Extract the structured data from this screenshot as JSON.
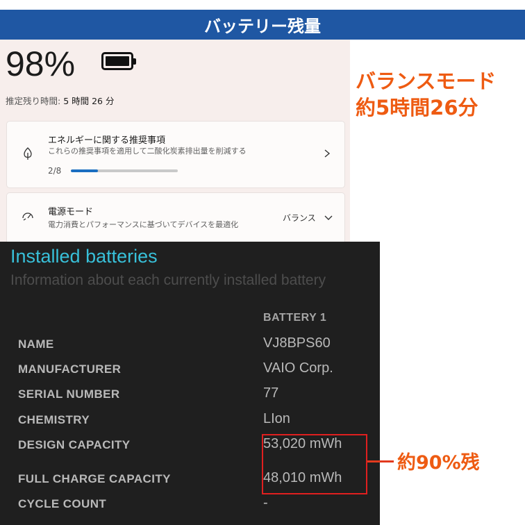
{
  "title": "バッテリー残量",
  "settings": {
    "percentage": "98%",
    "remaining_label": "推定残り時間:",
    "remaining_value": "5 時間 26 分",
    "recommendation": {
      "title": "エネルギーに関する推奨事項",
      "subtitle": "これらの推奨事項を適用して二酸化炭素排出量を削減する",
      "progress_label": "2/8",
      "progress_fraction": 0.25,
      "icon": "leaf-icon"
    },
    "power_mode": {
      "title": "電源モード",
      "subtitle": "電力消費とパフォーマンスに基づいてデバイスを最適化",
      "value": "バランス",
      "icon": "power-mode-gauge-icon"
    }
  },
  "annotations": {
    "mode_line1": "バランスモード",
    "mode_line2": "約5時間26分",
    "capacity_note": "約90%残"
  },
  "report": {
    "title": "Installed batteries",
    "subtitle": "Information about each currently installed battery",
    "column_header": "BATTERY 1",
    "rows": [
      {
        "label": "NAME",
        "value": "VJ8BPS60"
      },
      {
        "label": "MANUFACTURER",
        "value": "VAIO Corp."
      },
      {
        "label": "SERIAL NUMBER",
        "value": "77"
      },
      {
        "label": "CHEMISTRY",
        "value": "LIon"
      },
      {
        "label": "DESIGN CAPACITY",
        "value": "53,020 mWh"
      },
      {
        "label": "FULL CHARGE CAPACITY",
        "value": "48,010 mWh"
      },
      {
        "label": "CYCLE COUNT",
        "value": "-"
      }
    ]
  },
  "colors": {
    "title_bar": "#1f57a3",
    "annotation": "#ee5b12",
    "highlight_box": "#e01f1f",
    "report_title": "#38c0d9",
    "progress": "#1a6ec1"
  }
}
